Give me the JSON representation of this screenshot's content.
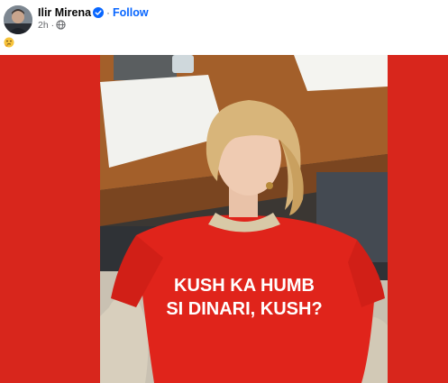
{
  "post": {
    "author": "Ilir Mirena",
    "follow_label": "Follow",
    "separator": "·",
    "time": "2h ·",
    "caption_emoji": "thinking-face-emoji",
    "verified_icon": "verified-badge-icon",
    "audience_icon": "globe-icon"
  },
  "photo": {
    "shirt_text_line1": "KUSH KA HUMB",
    "shirt_text_line2": "SI DINARI, KUSH?"
  },
  "colors": {
    "background_red": "#d8261c",
    "link_blue": "#0866ff",
    "meta_gray": "#65676b",
    "shirt_red": "#e0241b"
  }
}
